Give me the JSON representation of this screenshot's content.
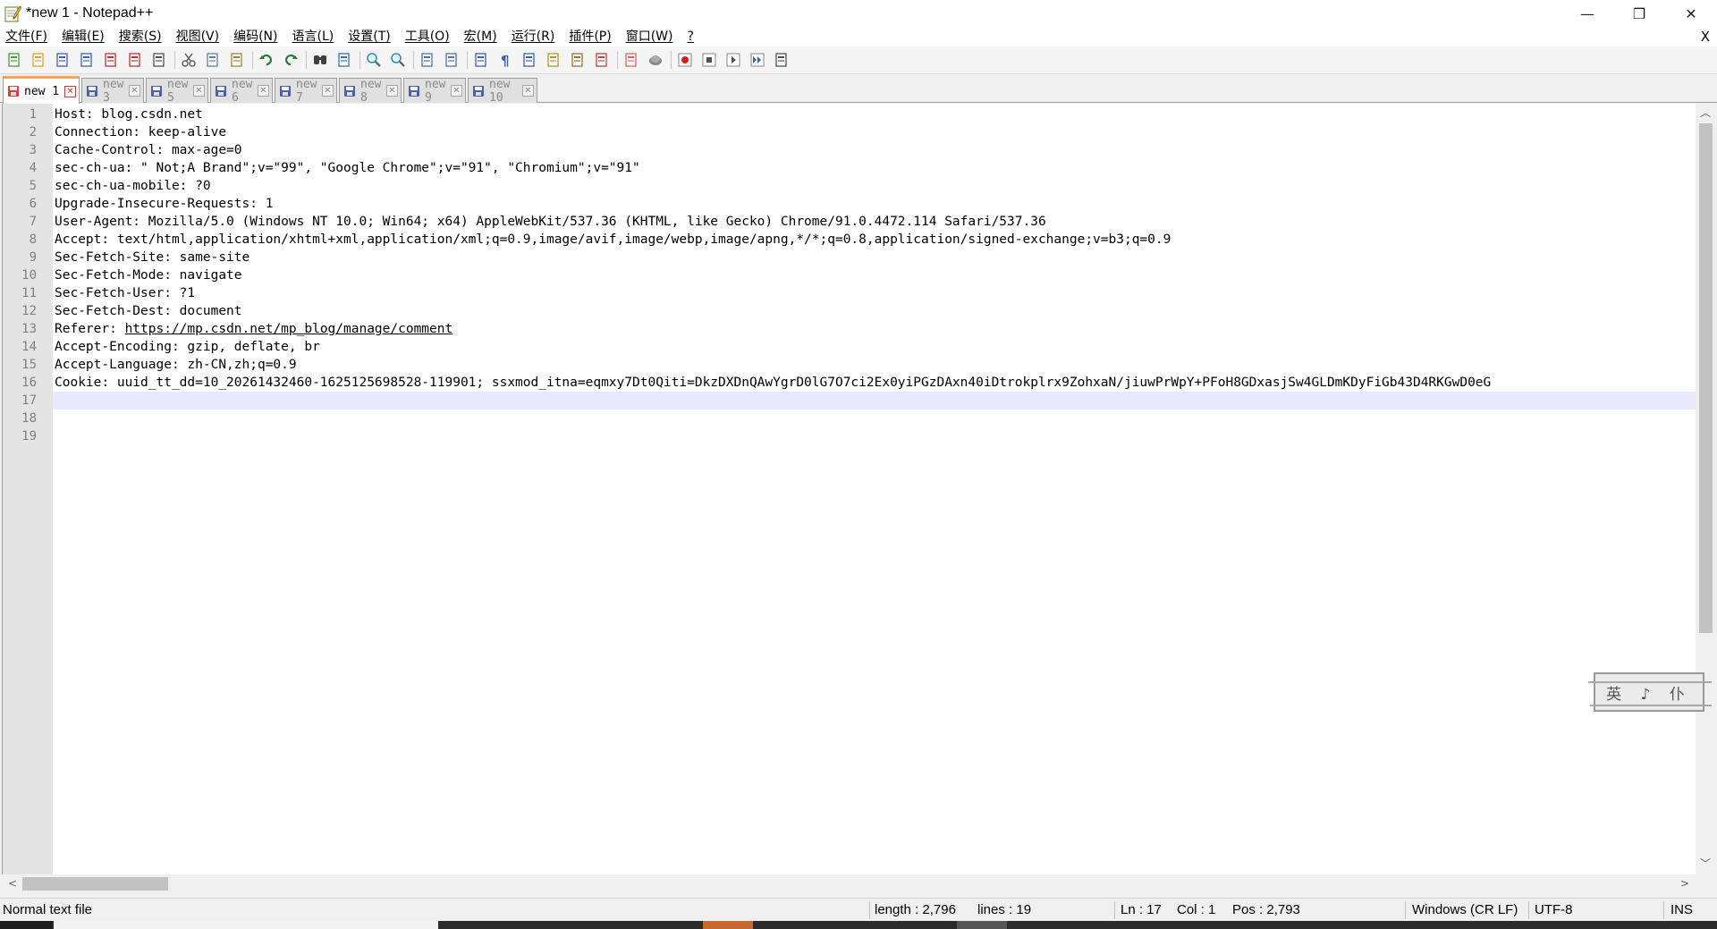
{
  "window": {
    "title": "*new 1 - Notepad++",
    "minimize": "—",
    "restore": "❐",
    "close": "✕"
  },
  "menu": {
    "items": [
      "文件(F)",
      "编辑(E)",
      "搜索(S)",
      "视图(V)",
      "编码(N)",
      "语言(L)",
      "设置(T)",
      "工具(O)",
      "宏(M)",
      "运行(R)",
      "插件(P)",
      "窗口(W)",
      "?"
    ],
    "close": "X"
  },
  "toolbar": {
    "icons": [
      "new-file-icon",
      "open-file-icon",
      "save-icon",
      "save-all-icon",
      "close-icon",
      "close-all-icon",
      "print-icon",
      "cut-icon",
      "copy-icon",
      "paste-icon",
      "undo-icon",
      "redo-icon",
      "find-icon",
      "replace-icon",
      "zoom-in-icon",
      "zoom-out-icon",
      "sync-vertical-icon",
      "sync-horizontal-icon",
      "word-wrap-icon",
      "show-all-chars-icon",
      "indent-guide-icon",
      "udl-icon",
      "doc-map-icon",
      "function-list-icon",
      "folder-workspace-icon",
      "monitoring-icon",
      "record-macro-icon",
      "stop-record-icon",
      "play-macro-icon",
      "run-macro-multiple-icon",
      "save-macro-icon"
    ]
  },
  "tabs": [
    {
      "label": "new 1",
      "active": true
    },
    {
      "label": "new 3",
      "active": false
    },
    {
      "label": "new 5",
      "active": false
    },
    {
      "label": "new 6",
      "active": false
    },
    {
      "label": "new 7",
      "active": false
    },
    {
      "label": "new 8",
      "active": false
    },
    {
      "label": "new 9",
      "active": false
    },
    {
      "label": "new 10",
      "active": false
    }
  ],
  "editor": {
    "current_line": 17,
    "lines": [
      "Host: blog.csdn.net",
      "Connection: keep-alive",
      "Cache-Control: max-age=0",
      "sec-ch-ua: \" Not;A Brand\";v=\"99\", \"Google Chrome\";v=\"91\", \"Chromium\";v=\"91\"",
      "sec-ch-ua-mobile: ?0",
      "Upgrade-Insecure-Requests: 1",
      "User-Agent: Mozilla/5.0 (Windows NT 10.0; Win64; x64) AppleWebKit/537.36 (KHTML, like Gecko) Chrome/91.0.4472.114 Safari/537.36",
      "Accept: text/html,application/xhtml+xml,application/xml;q=0.9,image/avif,image/webp,image/apng,*/*;q=0.8,application/signed-exchange;v=b3;q=0.9",
      "Sec-Fetch-Site: same-site",
      "Sec-Fetch-Mode: navigate",
      "Sec-Fetch-User: ?1",
      "Sec-Fetch-Dest: document",
      "Referer: https://mp.csdn.net/mp_blog/manage/comment",
      "Accept-Encoding: gzip, deflate, br",
      "Accept-Language: zh-CN,zh;q=0.9",
      "Cookie: uuid_tt_dd=10_20261432460-1625125698528-119901; ssxmod_itna=eqmxy7Dt0Qiti=DkzDXDnQAwYgrD0lG7O7ci2Ex0yiPGzDAxn40iDtrokplrx9ZohxaN/jiuwPrWpY+PFoH8GDxasjSw4GLDmKDyFiGb43D4RKGwD0eG",
      "",
      "",
      ""
    ],
    "referer_prefix": "Referer: ",
    "referer_link": "https://mp.csdn.net/mp_blog/manage/comment"
  },
  "scroll": {
    "up": "︿",
    "down": "﹀",
    "left": "<",
    "right": ">"
  },
  "status": {
    "file_type": "Normal text file",
    "length": "length : 2,796",
    "lines": "lines : 19",
    "ln": "Ln : 17",
    "col": "Col : 1",
    "pos": "Pos : 2,793",
    "eol": "Windows (CR LF)",
    "encoding": "UTF-8",
    "mode": "INS"
  },
  "ime": {
    "text": "英 ♪ 仆"
  }
}
